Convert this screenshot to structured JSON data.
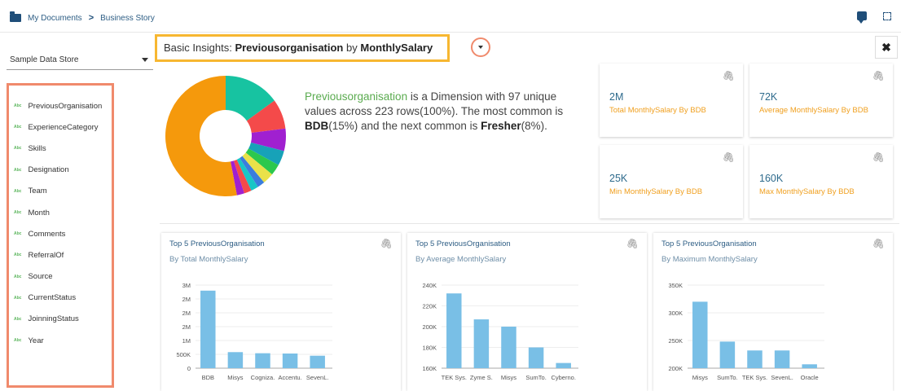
{
  "breadcrumb": {
    "root": "My Documents",
    "separator": ">",
    "current": "Business Story"
  },
  "topbar_icons": [
    "chat-icon",
    "expand-icon"
  ],
  "sidebar": {
    "store": "Sample Data Store",
    "dimensions": [
      "PreviousOrganisation",
      "ExperienceCategory",
      "Skills",
      "Designation",
      "Team",
      "Month",
      "Comments",
      "ReferralOf",
      "Source",
      "CurrentStatus",
      "JoinningStatus",
      "Year"
    ],
    "type_badge": "Abc"
  },
  "header": {
    "prefix": "Basic Insights:",
    "dimension": "Previousorganisation",
    "by": "by",
    "measure": "MonthlySalary",
    "close": "✖"
  },
  "insight": {
    "dim": "Previousorganisation",
    "text1": " is a Dimension with 97 unique values across 223 rows(100%). The most common is ",
    "top1": "BDB",
    "text2": "(15%) and the next common is ",
    "top2": "Fresher",
    "text3": "(8%)."
  },
  "donut": {
    "slices": [
      {
        "value": 15,
        "color": "#17c3a1"
      },
      {
        "value": 8,
        "color": "#f44a4a"
      },
      {
        "value": 6,
        "color": "#a020d0"
      },
      {
        "value": 4,
        "color": "#17a2b8"
      },
      {
        "value": 3,
        "color": "#2cc84d"
      },
      {
        "value": 3,
        "color": "#e9e14a"
      },
      {
        "value": 2,
        "color": "#3b7ddd"
      },
      {
        "value": 2,
        "color": "#18c6c6"
      },
      {
        "value": 2,
        "color": "#f44a4a"
      },
      {
        "value": 2,
        "color": "#a020d0"
      },
      {
        "value": 53,
        "color": "#f5990c"
      }
    ]
  },
  "stats": [
    {
      "value": "2M",
      "label": "Total MonthlySalary By BDB"
    },
    {
      "value": "72K",
      "label": "Average MonthlySalary By BDB"
    },
    {
      "value": "25K",
      "label": "Min MonthlySalary By BDB"
    },
    {
      "value": "160K",
      "label": "Max MonthlySalary By BDB"
    }
  ],
  "chart_data": [
    {
      "type": "bar",
      "title": "Top 5 PreviousOrganisation",
      "subtitle": "By Total MonthlySalary",
      "categories": [
        "BDB",
        "Misys",
        "Cogniza.",
        "Accentu.",
        "SevenL."
      ],
      "values": [
        2800000,
        580000,
        540000,
        530000,
        450000
      ],
      "ylim": [
        0,
        3000000
      ],
      "yticks": [
        0,
        500000,
        1000000,
        1500000,
        2000000,
        2500000,
        3000000
      ],
      "ytick_labels": [
        "0",
        "500K",
        "1M",
        "2M",
        "2M",
        "2M",
        "3M"
      ],
      "color": "#79bfe6"
    },
    {
      "type": "bar",
      "title": "Top 5 PreviousOrganisation",
      "subtitle": "By Average MonthlySalary",
      "categories": [
        "TEK Sys.",
        "Zyme S.",
        "Misys",
        "SumTo.",
        "Cyberno."
      ],
      "values": [
        232000,
        207000,
        200000,
        180000,
        165000
      ],
      "ylim": [
        160000,
        240000
      ],
      "yticks": [
        160000,
        180000,
        200000,
        220000,
        240000
      ],
      "ytick_labels": [
        "160K",
        "180K",
        "200K",
        "220K",
        "240K"
      ],
      "color": "#79bfe6"
    },
    {
      "type": "bar",
      "title": "Top 5 PreviousOrganisation",
      "subtitle": "By Maximum MonthlySalary",
      "categories": [
        "Misys",
        "SumTo.",
        "TEK Sys.",
        "SevenL.",
        "Oracle"
      ],
      "values": [
        320000,
        248000,
        232000,
        232000,
        207000
      ],
      "ylim": [
        200000,
        350000
      ],
      "yticks": [
        200000,
        250000,
        300000,
        350000
      ],
      "ytick_labels": [
        "200K",
        "250K",
        "300K",
        "350K"
      ],
      "color": "#79bfe6"
    }
  ]
}
